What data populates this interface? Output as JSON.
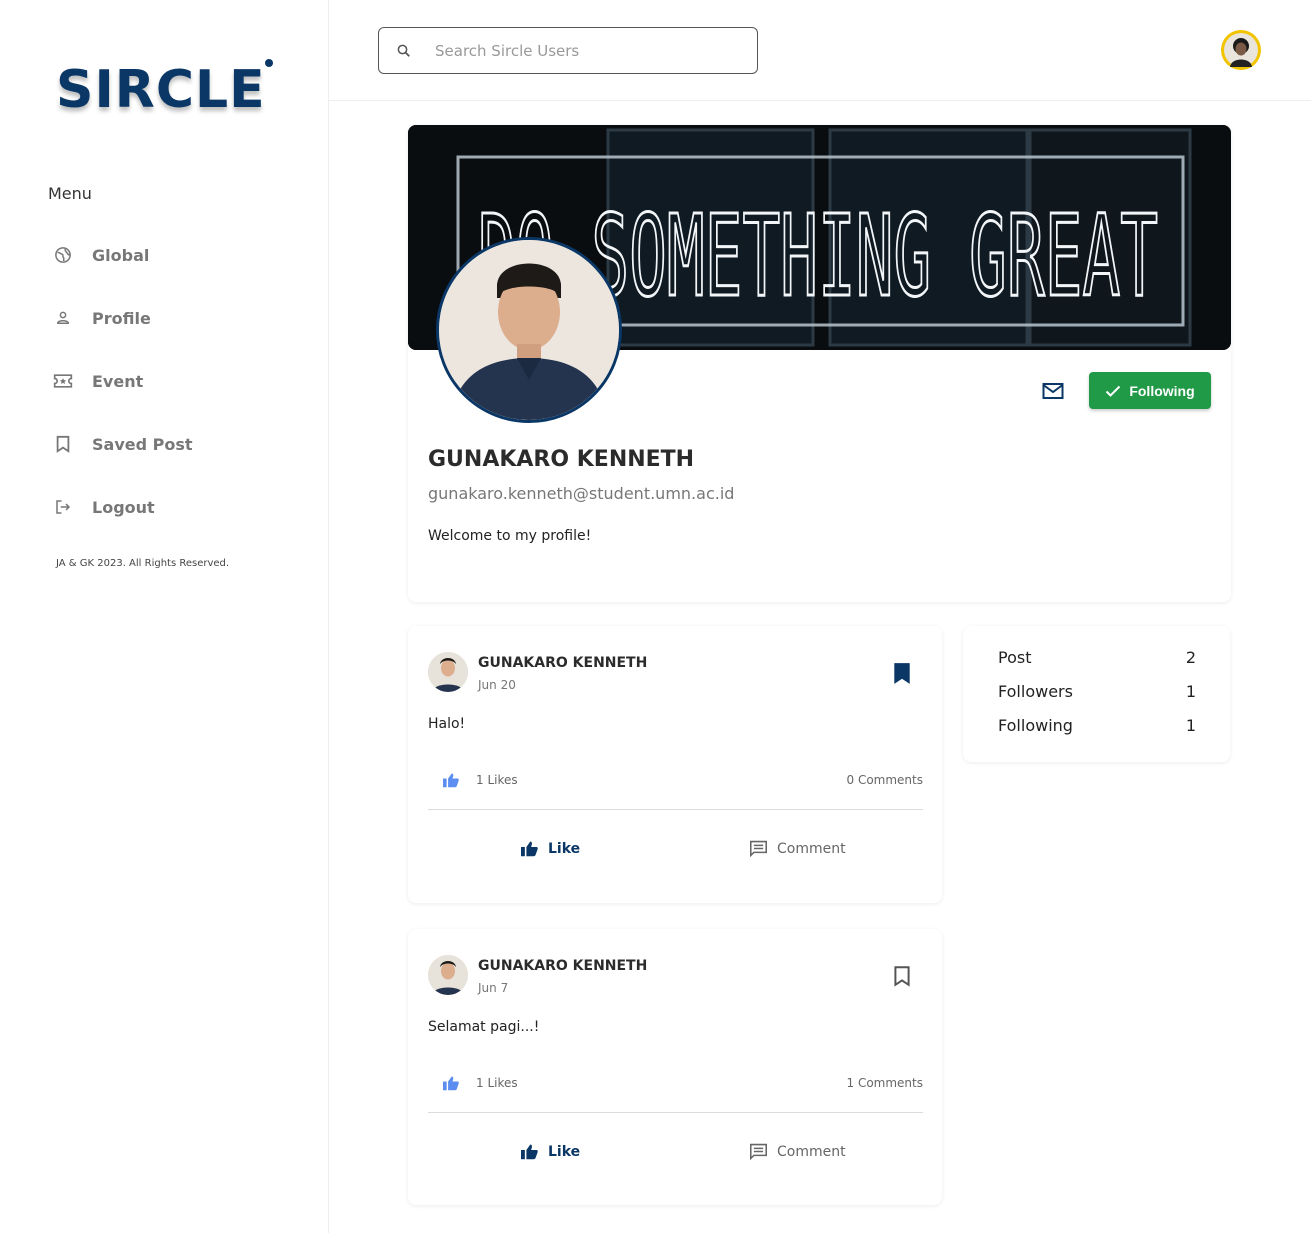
{
  "app": {
    "logo_text": "SIRCLE",
    "brand_color": "#0b3766"
  },
  "sidebar": {
    "menu_label": "Menu",
    "items": [
      {
        "label": "Global",
        "icon": "globe-icon"
      },
      {
        "label": "Profile",
        "icon": "person-icon"
      },
      {
        "label": "Event",
        "icon": "ticket-icon"
      },
      {
        "label": "Saved Post",
        "icon": "bookmark-icon"
      },
      {
        "label": "Logout",
        "icon": "logout-icon"
      }
    ],
    "copyright": "JA & GK 2023. All Rights Reserved."
  },
  "header": {
    "search_placeholder": "Search Sircle Users"
  },
  "profile": {
    "banner_text": "DO SOMETHING GREAT",
    "name": "GUNAKARO KENNETH",
    "email": "gunakaro.kenneth@student.umn.ac.id",
    "bio": "Welcome to my profile!",
    "follow_button": "Following",
    "follow_color": "#219a48"
  },
  "posts": [
    {
      "author": "GUNAKARO KENNETH",
      "date": "Jun 20",
      "text": "Halo!",
      "likes": "1 Likes",
      "comments": "0 Comments",
      "bookmarked": true,
      "like_label": "Like",
      "comment_label": "Comment"
    },
    {
      "author": "GUNAKARO KENNETH",
      "date": "Jun 7",
      "text": "Selamat pagi...!",
      "likes": "1 Likes",
      "comments": "1 Comments",
      "bookmarked": false,
      "like_label": "Like",
      "comment_label": "Comment"
    }
  ],
  "stats": [
    {
      "label": "Post",
      "value": "2"
    },
    {
      "label": "Followers",
      "value": "1"
    },
    {
      "label": "Following",
      "value": "1"
    }
  ]
}
